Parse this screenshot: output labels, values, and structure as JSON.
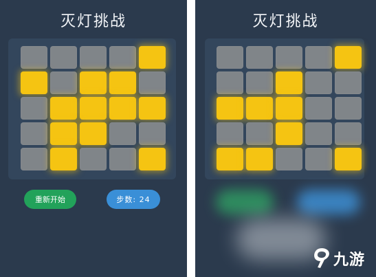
{
  "colors": {
    "background": "#2b3a4d",
    "board": "#33465c",
    "cell_off": "#808589",
    "cell_on": "#f5c412",
    "restart_button": "#22a25a",
    "steps_button": "#3a8fd7"
  },
  "left_screen": {
    "title": "灭灯挑战",
    "grid": [
      [
        0,
        0,
        0,
        0,
        1
      ],
      [
        1,
        0,
        1,
        1,
        0
      ],
      [
        0,
        1,
        1,
        1,
        1
      ],
      [
        0,
        1,
        1,
        0,
        0
      ],
      [
        0,
        1,
        0,
        0,
        1
      ]
    ],
    "restart_label": "重新开始",
    "steps_label": "步数: 24"
  },
  "right_screen": {
    "title": "灭灯挑战",
    "grid": [
      [
        0,
        0,
        0,
        0,
        1
      ],
      [
        0,
        0,
        1,
        0,
        0
      ],
      [
        1,
        1,
        1,
        0,
        0
      ],
      [
        0,
        0,
        1,
        0,
        0
      ],
      [
        1,
        1,
        0,
        0,
        1
      ]
    ]
  },
  "watermark": {
    "text": "九游",
    "icon": "jiuyou-logo-icon"
  }
}
